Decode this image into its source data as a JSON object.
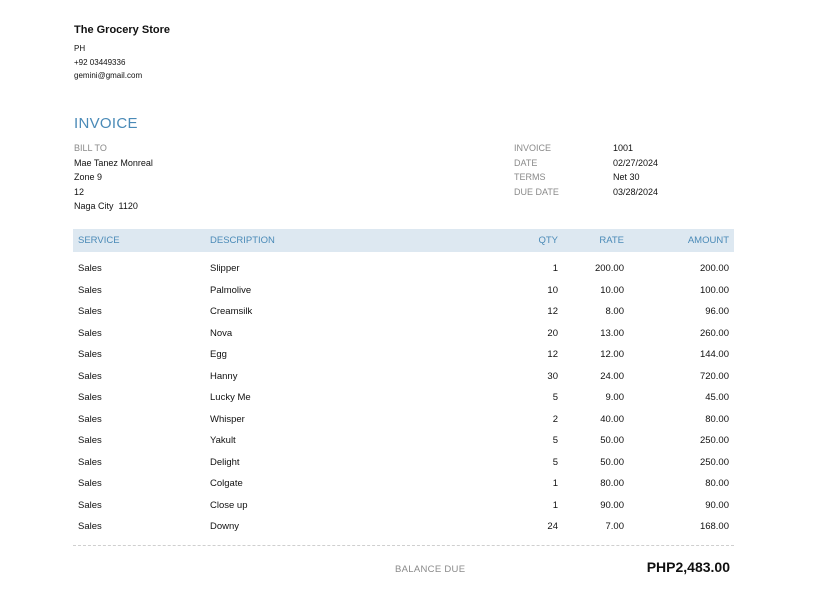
{
  "company": {
    "name": "The Grocery Store",
    "country": "PH",
    "phone": "+92 03449336",
    "email": "gemini@gmail.com"
  },
  "invoice_title": "INVOICE",
  "bill_to": {
    "label": "BILL TO",
    "lines": [
      "Mae Tanez Monreal",
      "Zone 9",
      "12",
      "Naga City  1120"
    ]
  },
  "meta": [
    {
      "label": "INVOICE",
      "value": "1001"
    },
    {
      "label": "DATE",
      "value": "02/27/2024"
    },
    {
      "label": "TERMS",
      "value": "Net 30"
    },
    {
      "label": "DUE DATE",
      "value": "03/28/2024"
    }
  ],
  "table": {
    "headers": {
      "service": "SERVICE",
      "description": "DESCRIPTION",
      "qty": "QTY",
      "rate": "RATE",
      "amount": "AMOUNT"
    },
    "rows": [
      {
        "service": "Sales",
        "description": "Slipper",
        "qty": "1",
        "rate": "200.00",
        "amount": "200.00"
      },
      {
        "service": "Sales",
        "description": "Palmolive",
        "qty": "10",
        "rate": "10.00",
        "amount": "100.00"
      },
      {
        "service": "Sales",
        "description": "Creamsilk",
        "qty": "12",
        "rate": "8.00",
        "amount": "96.00"
      },
      {
        "service": "Sales",
        "description": "Nova",
        "qty": "20",
        "rate": "13.00",
        "amount": "260.00"
      },
      {
        "service": "Sales",
        "description": "Egg",
        "qty": "12",
        "rate": "12.00",
        "amount": "144.00"
      },
      {
        "service": "Sales",
        "description": "Hanny",
        "qty": "30",
        "rate": "24.00",
        "amount": "720.00"
      },
      {
        "service": "Sales",
        "description": "Lucky Me",
        "qty": "5",
        "rate": "9.00",
        "amount": "45.00"
      },
      {
        "service": "Sales",
        "description": "Whisper",
        "qty": "2",
        "rate": "40.00",
        "amount": "80.00"
      },
      {
        "service": "Sales",
        "description": "Yakult",
        "qty": "5",
        "rate": "50.00",
        "amount": "250.00"
      },
      {
        "service": "Sales",
        "description": "Delight",
        "qty": "5",
        "rate": "50.00",
        "amount": "250.00"
      },
      {
        "service": "Sales",
        "description": "Colgate",
        "qty": "1",
        "rate": "80.00",
        "amount": "80.00"
      },
      {
        "service": "Sales",
        "description": "Close up",
        "qty": "1",
        "rate": "90.00",
        "amount": "90.00"
      },
      {
        "service": "Sales",
        "description": "Downy",
        "qty": "24",
        "rate": "7.00",
        "amount": "168.00"
      }
    ]
  },
  "balance": {
    "label": "BALANCE DUE",
    "value": "PHP2,483.00"
  },
  "colors": {
    "accent": "#4a8ab7",
    "header_bg": "#dde8f1",
    "muted": "#8a8a8a"
  }
}
